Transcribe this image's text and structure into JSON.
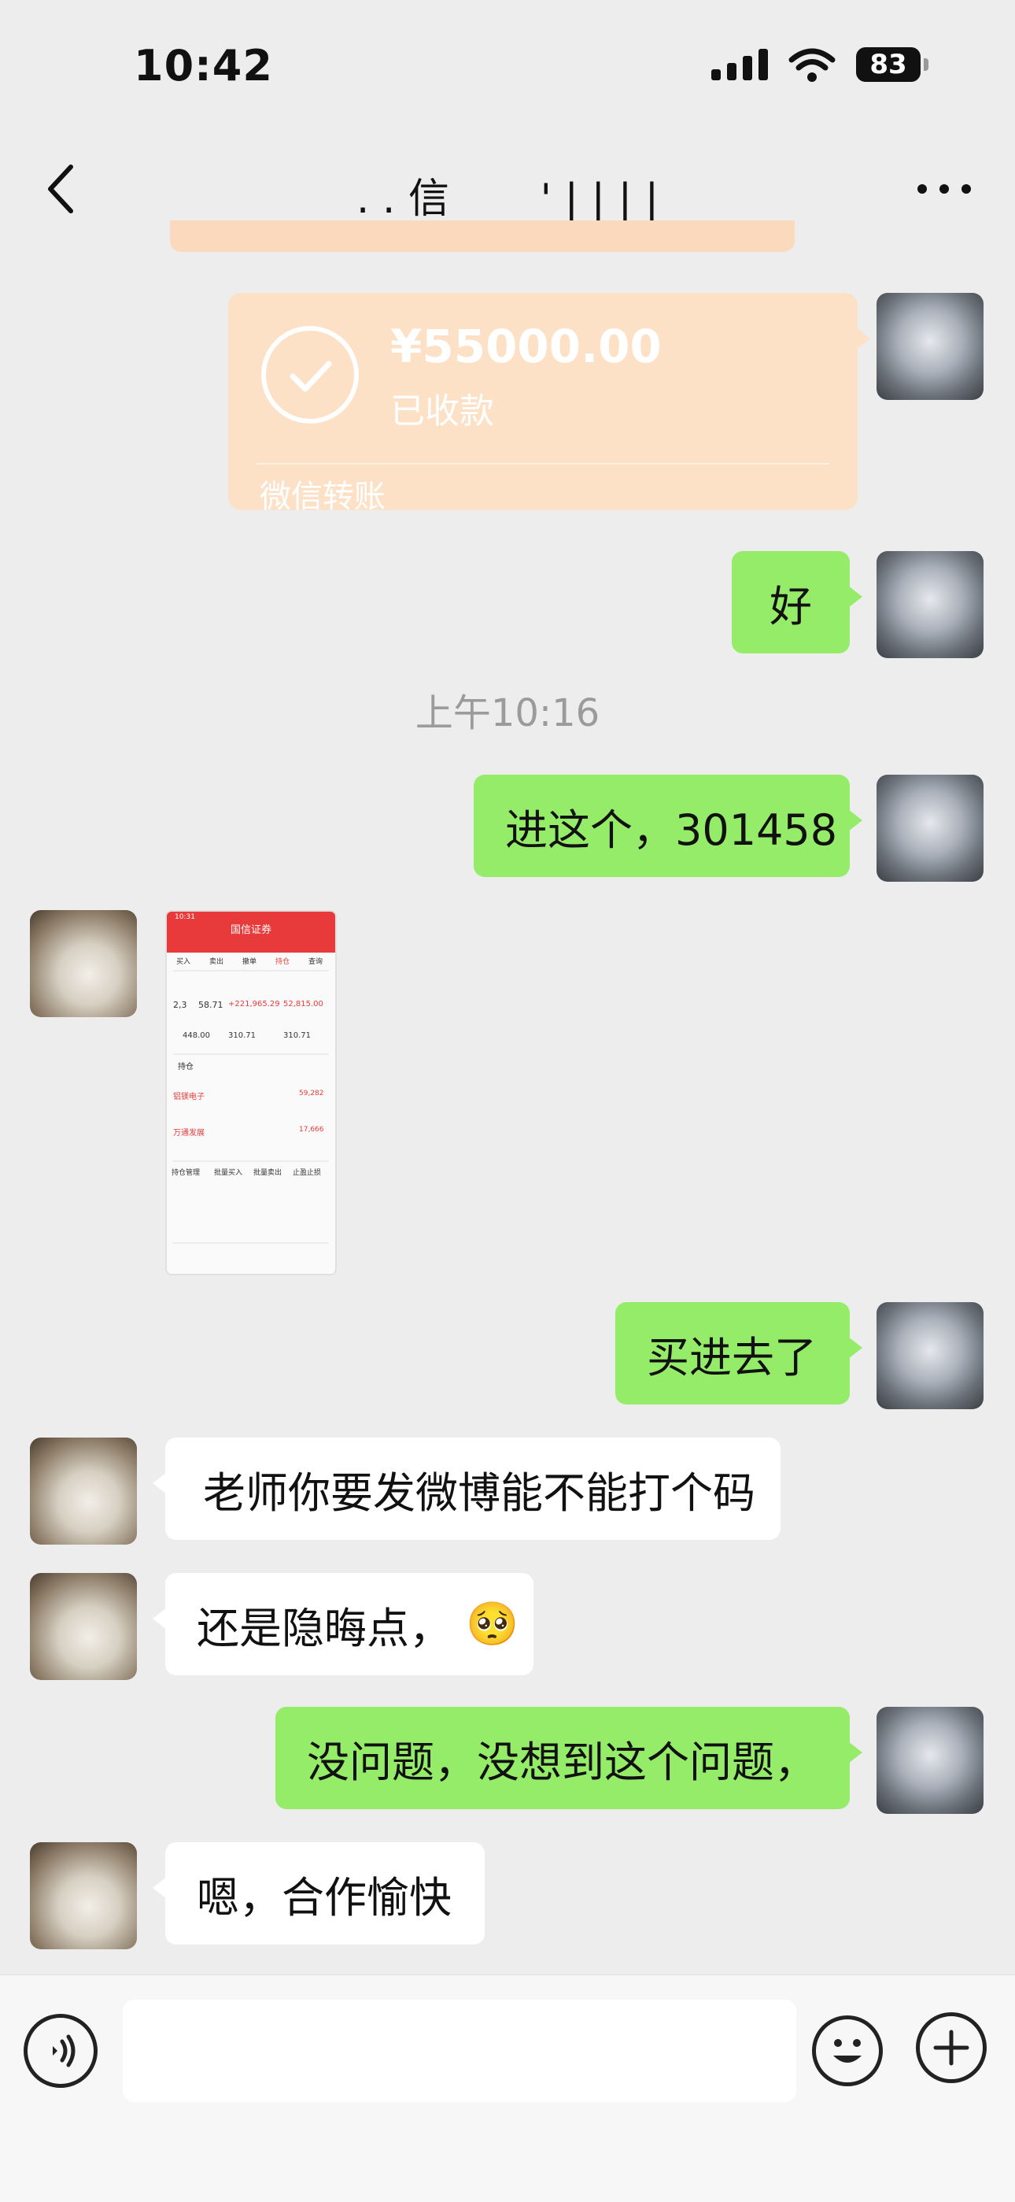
{
  "status_bar": {
    "time": "10:42",
    "battery_level": "83",
    "icons": [
      "signal-icon",
      "wifi-icon",
      "battery-icon"
    ]
  },
  "nav": {
    "title": ". . 信       ' | | | |",
    "icons": [
      "back-arrow-icon",
      "more-icon"
    ]
  },
  "transfer": {
    "amount": "¥55000.00",
    "status": "已收款",
    "label": "微信转账",
    "icon": "check-circle-icon",
    "color": "#fde1c7"
  },
  "messages": {
    "m1": "好",
    "timestamp": "上午10:16",
    "m2": "进这个，301458",
    "m3": "买进去了",
    "m4": "老师你要发微博能不能打个码",
    "m5": "还是隐晦点，",
    "m5_emoji": "🥺",
    "m6": "没问题，没想到这个问题，",
    "m7": "嗯，合作愉快"
  },
  "screenshot": {
    "time": "10:31",
    "title": "国信证券",
    "tabs": [
      "买入",
      "卖出",
      "撤单",
      "持仓",
      "查询"
    ],
    "summary": [
      "2,3",
      "58.71",
      "+221,965.29",
      "52,815.00",
      "448.00",
      "310.71",
      "310.71"
    ],
    "holdings_header": "持仓",
    "holdings": [
      {
        "name": "铝镁电子",
        "value": "59,282"
      },
      {
        "name": "万通发展",
        "value": "17,666"
      }
    ],
    "bottom_tabs": [
      "持仓管理",
      "批量买入",
      "批量卖出",
      "止盈止损"
    ]
  },
  "colors": {
    "green_bubble": "#95ec69",
    "white_bubble": "#ffffff",
    "background": "#ededed",
    "brand_red": "#e83a3a"
  },
  "input_bar": {
    "icons": [
      "voice-icon",
      "emoji-icon",
      "plus-icon"
    ]
  }
}
